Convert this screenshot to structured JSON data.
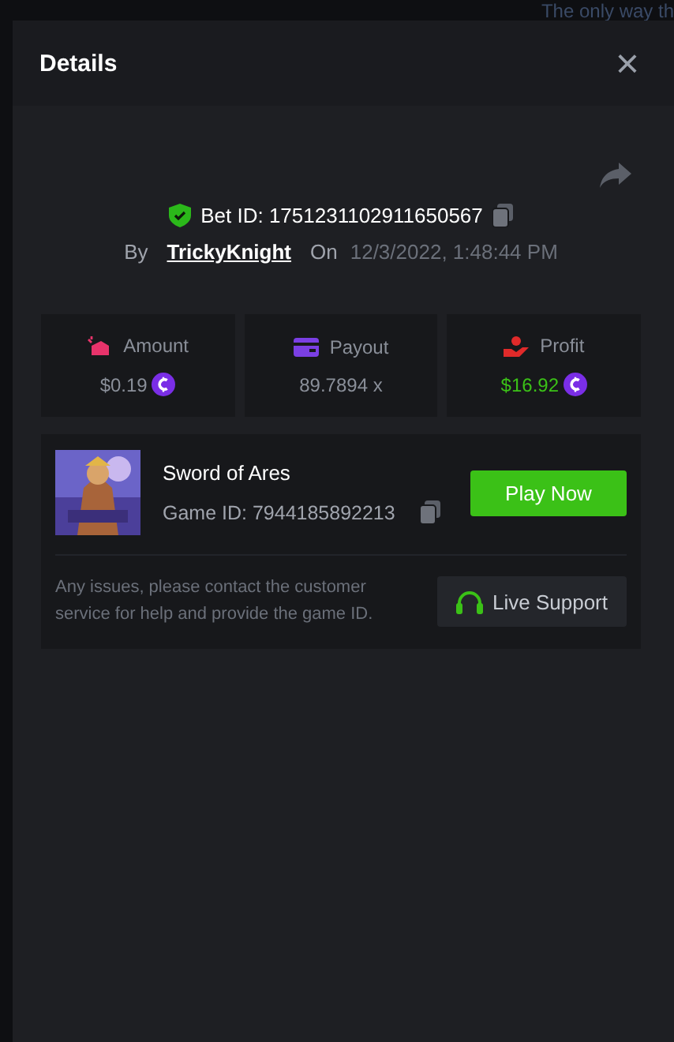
{
  "backdrop": {
    "text": "The only way th"
  },
  "modal": {
    "title": "Details",
    "close": "×"
  },
  "bet": {
    "id_label": "Bet ID: 1751231102911650567",
    "verified": true,
    "by_label": "By",
    "user": "TrickyKnight",
    "on_label": "On",
    "date": "12/3/2022, 1:48:44 PM"
  },
  "stats": [
    {
      "kind": "amount",
      "label": "Amount",
      "value": "$0.19",
      "coin": true,
      "color": "#e8336b"
    },
    {
      "kind": "payout",
      "label": "Payout",
      "value": "89.7894 x",
      "coin": false,
      "color": "#7b3fe4"
    },
    {
      "kind": "profit",
      "label": "Profit",
      "value": "$16.92",
      "coin": true,
      "color": "#e02a2a",
      "positive": true
    }
  ],
  "game": {
    "kind": "picture",
    "name": "Sword of Ares",
    "game_id": "Game ID: 7944185892213",
    "play": "Play Now",
    "note": "Any issues, please contact the customer service for help and provide the game ID.",
    "support": "Live Support"
  }
}
